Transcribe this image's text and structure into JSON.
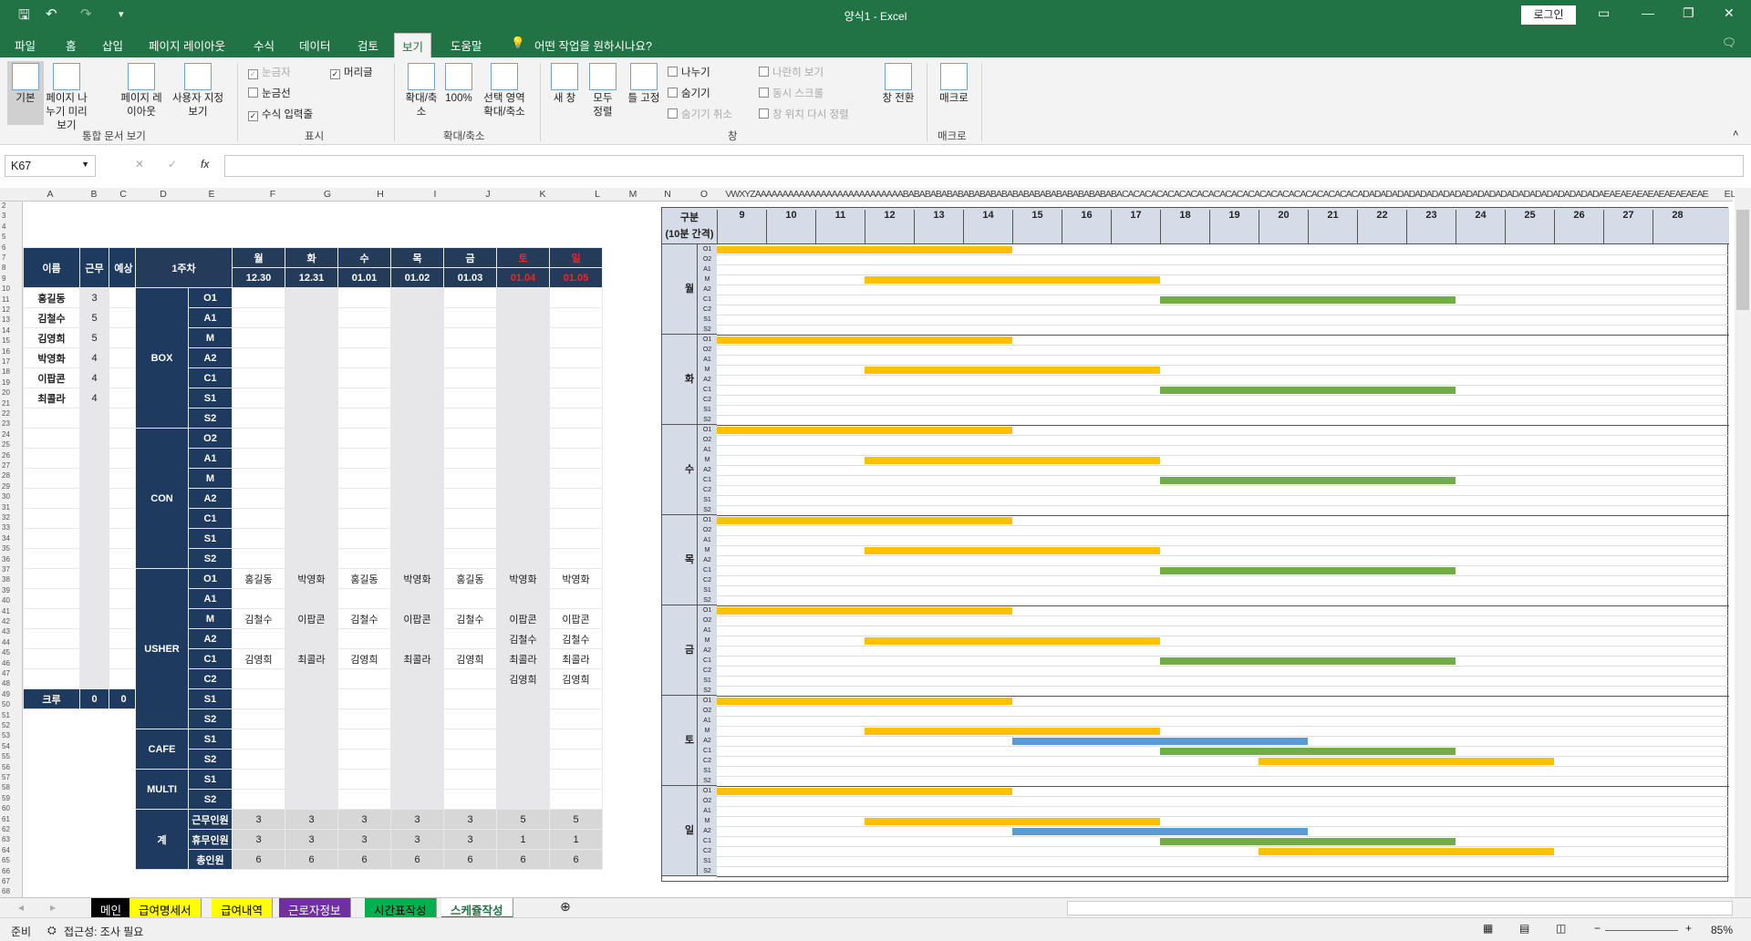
{
  "window": {
    "title": "양식1  -  Excel",
    "login": "로그인"
  },
  "tabs": [
    "파일",
    "홈",
    "삽입",
    "페이지 레이아웃",
    "수식",
    "데이터",
    "검토",
    "보기",
    "도움말",
    "어떤 작업을 원하시나요?"
  ],
  "ribbon": {
    "workbook_views": [
      "기본",
      "페이지 나누기 미리 보기",
      "페이지 레이아웃",
      "사용자 지정 보기"
    ],
    "show": {
      "ruler": "눈금자",
      "gridlines": "눈금선",
      "formula_bar": "수식 입력줄",
      "headings": "머리글"
    },
    "zoom": [
      "확대/축소",
      "100%",
      "선택 영역 확대/축소"
    ],
    "window": [
      "새 창",
      "모두 정렬",
      "틀 고정",
      "나누기",
      "숨기기",
      "숨기기 취소",
      "나란히 보기",
      "동시 스크롤",
      "창 위치 다시 정렬",
      "창 전환"
    ],
    "macros": "매크로",
    "groups": [
      "통합 문서 보기",
      "표시",
      "확대/축소",
      "창",
      "매크로"
    ]
  },
  "formula_bar": {
    "name_box": "K67",
    "fx": "fx",
    "value": ""
  },
  "columns": [
    "A",
    "B",
    "C",
    "D",
    "E",
    "F",
    "G",
    "H",
    "I",
    "J",
    "K",
    "L",
    "M",
    "N",
    "O",
    "VWXYZAAAAAAAAAAAAAAAAAAAAAAAAAAABABABABABABABABABABABABABABABABABABABABACACACACACACACACACACACACACACACACACACACACACADADADADADADADADADADADADADADADADADADADADADAEAEAEAEAEAEAEAEAEAE",
    "EL"
  ],
  "rows": [
    "2",
    "3",
    "4",
    "5",
    "6",
    "7",
    "8",
    "9",
    "10",
    "11",
    "12",
    "13",
    "14",
    "15",
    "16",
    "17",
    "18",
    "19",
    "20",
    "21",
    "22",
    "23",
    "24",
    "25",
    "26",
    "27",
    "28",
    "29",
    "30",
    "31",
    "32",
    "33",
    "34",
    "35",
    "36",
    "37",
    "38",
    "39",
    "40",
    "41",
    "42",
    "43",
    "44",
    "45",
    "46",
    "47",
    "48",
    "49",
    "50",
    "51",
    "52",
    "53",
    "54",
    "55",
    "56",
    "57",
    "58",
    "59",
    "60",
    "61",
    "62",
    "63",
    "64",
    "65",
    "66",
    "67",
    "68"
  ],
  "roster": {
    "headers": [
      "이름",
      "근무",
      "예상"
    ],
    "names": [
      "홍길동",
      "김철수",
      "김영희",
      "박영화",
      "이팝콘",
      "최콜라"
    ],
    "work": [
      "3",
      "5",
      "5",
      "4",
      "4",
      "4"
    ],
    "crew_label": "크루",
    "crew_work": "0",
    "crew_expected": "0"
  },
  "schedule": {
    "week": "1주차",
    "days": [
      "월",
      "화",
      "수",
      "목",
      "금",
      "토",
      "일"
    ],
    "dates": [
      "12.30",
      "12.31",
      "01.01",
      "01.02",
      "01.03",
      "01.04",
      "01.05"
    ],
    "groups": [
      {
        "name": "BOX",
        "slots": [
          "O1",
          "A1",
          "M",
          "A2",
          "C1",
          "S1",
          "S2"
        ]
      },
      {
        "name": "CON",
        "slots": [
          "O2",
          "A1",
          "M",
          "A2",
          "C1",
          "S1",
          "S2"
        ]
      },
      {
        "name": "USHER",
        "slots": [
          "O1",
          "A1",
          "M",
          "A2",
          "C1",
          "C2",
          "S1",
          "S2"
        ]
      },
      {
        "name": "CAFE",
        "slots": [
          "S1",
          "S2"
        ]
      },
      {
        "name": "MULTI",
        "slots": [
          "S1",
          "S2"
        ]
      }
    ],
    "usher": {
      "O1": [
        "홍길동",
        "박영화",
        "홍길동",
        "박영화",
        "홍길동",
        "박영화",
        "박영화"
      ],
      "M": [
        "김철수",
        "이팝콘",
        "김철수",
        "이팝콘",
        "김철수",
        "이팝콘",
        "이팝콘"
      ],
      "A2": [
        "",
        "",
        "",
        "",
        "",
        "김철수",
        "김철수"
      ],
      "C1": [
        "김영희",
        "최콜라",
        "김영희",
        "최콜라",
        "김영희",
        "최콜라",
        "최콜라"
      ],
      "C2": [
        "",
        "",
        "",
        "",
        "",
        "김영희",
        "김영희"
      ]
    },
    "totals": {
      "label": "계",
      "rows": [
        {
          "label": "근무인원",
          "values": [
            "3",
            "3",
            "3",
            "3",
            "3",
            "5",
            "5"
          ]
        },
        {
          "label": "휴무인원",
          "values": [
            "3",
            "3",
            "3",
            "3",
            "3",
            "1",
            "1"
          ]
        },
        {
          "label": "총인원",
          "values": [
            "6",
            "6",
            "6",
            "6",
            "6",
            "6",
            "6"
          ]
        }
      ]
    }
  },
  "timeline": {
    "header": "구분",
    "subheader": "(10분 간격)",
    "hours": [
      "9",
      "10",
      "11",
      "12",
      "13",
      "14",
      "15",
      "16",
      "17",
      "18",
      "19",
      "20",
      "21",
      "22",
      "23",
      "24",
      "25",
      "26",
      "27",
      "28"
    ],
    "slots": [
      "O1",
      "O2",
      "A1",
      "M",
      "A2",
      "C1",
      "C2",
      "S1",
      "S2"
    ],
    "days": [
      "월",
      "화",
      "수",
      "목",
      "금",
      "토",
      "일"
    ],
    "colors": {
      "yellow": "#ffc000",
      "green": "#70ad47",
      "blue": "#5b9bd5"
    },
    "bars": [
      {
        "day": 0,
        "slot": 0,
        "start": 9,
        "end": 15,
        "color": "yellow"
      },
      {
        "day": 0,
        "slot": 3,
        "start": 12,
        "end": 18,
        "color": "yellow"
      },
      {
        "day": 0,
        "slot": 5,
        "start": 18,
        "end": 24,
        "color": "green"
      },
      {
        "day": 1,
        "slot": 0,
        "start": 9,
        "end": 15,
        "color": "yellow"
      },
      {
        "day": 1,
        "slot": 3,
        "start": 12,
        "end": 18,
        "color": "yellow"
      },
      {
        "day": 1,
        "slot": 5,
        "start": 18,
        "end": 24,
        "color": "green"
      },
      {
        "day": 2,
        "slot": 0,
        "start": 9,
        "end": 15,
        "color": "yellow"
      },
      {
        "day": 2,
        "slot": 3,
        "start": 12,
        "end": 18,
        "color": "yellow"
      },
      {
        "day": 2,
        "slot": 5,
        "start": 18,
        "end": 24,
        "color": "green"
      },
      {
        "day": 3,
        "slot": 0,
        "start": 9,
        "end": 15,
        "color": "yellow"
      },
      {
        "day": 3,
        "slot": 3,
        "start": 12,
        "end": 18,
        "color": "yellow"
      },
      {
        "day": 3,
        "slot": 5,
        "start": 18,
        "end": 24,
        "color": "green"
      },
      {
        "day": 4,
        "slot": 0,
        "start": 9,
        "end": 15,
        "color": "yellow"
      },
      {
        "day": 4,
        "slot": 3,
        "start": 12,
        "end": 18,
        "color": "yellow"
      },
      {
        "day": 4,
        "slot": 5,
        "start": 18,
        "end": 24,
        "color": "green"
      },
      {
        "day": 5,
        "slot": 0,
        "start": 9,
        "end": 15,
        "color": "yellow"
      },
      {
        "day": 5,
        "slot": 3,
        "start": 12,
        "end": 18,
        "color": "yellow"
      },
      {
        "day": 5,
        "slot": 4,
        "start": 15,
        "end": 21,
        "color": "blue"
      },
      {
        "day": 5,
        "slot": 5,
        "start": 18,
        "end": 24,
        "color": "green"
      },
      {
        "day": 5,
        "slot": 6,
        "start": 20,
        "end": 26,
        "color": "yellow"
      },
      {
        "day": 6,
        "slot": 0,
        "start": 9,
        "end": 15,
        "color": "yellow"
      },
      {
        "day": 6,
        "slot": 3,
        "start": 12,
        "end": 18,
        "color": "yellow"
      },
      {
        "day": 6,
        "slot": 4,
        "start": 15,
        "end": 21,
        "color": "blue"
      },
      {
        "day": 6,
        "slot": 5,
        "start": 18,
        "end": 24,
        "color": "green"
      },
      {
        "day": 6,
        "slot": 6,
        "start": 20,
        "end": 26,
        "color": "yellow"
      }
    ]
  },
  "sheet_tabs": [
    {
      "label": "메인",
      "bg": "#000000",
      "fg": "#ffffff"
    },
    {
      "label": "급여명세서",
      "bg": "#ffff00",
      "fg": "#000000"
    },
    {
      "label": "급여내역",
      "bg": "#ffff00",
      "fg": "#000000"
    },
    {
      "label": "근로자정보",
      "bg": "#7030a0",
      "fg": "#ffffff"
    },
    {
      "label": "시간표작성",
      "bg": "#00b050",
      "fg": "#000000"
    },
    {
      "label": "스케쥴작성",
      "bg": "#ffffff",
      "fg": "#217346"
    }
  ],
  "status": {
    "ready": "준비",
    "accessibility": "접근성: 조사 필요",
    "zoom": "85%"
  }
}
